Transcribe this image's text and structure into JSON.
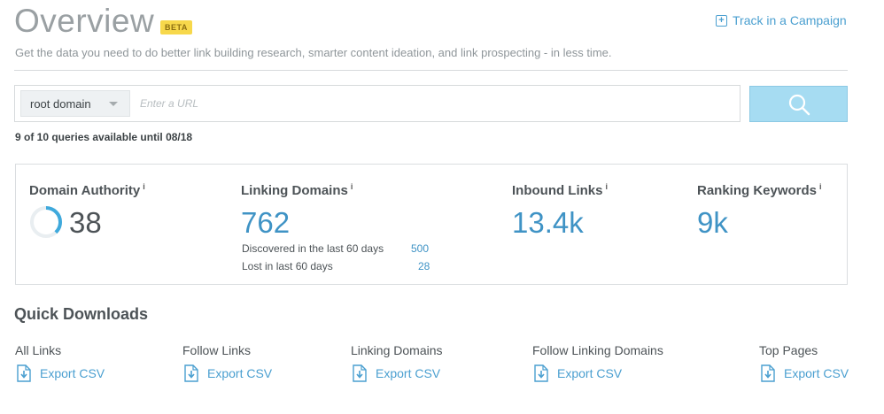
{
  "header": {
    "title": "Overview",
    "badge": "BETA",
    "track_link": "Track in a Campaign",
    "subtitle": "Get the data you need to do better link building research, smarter content ideation, and link prospecting - in less time."
  },
  "search": {
    "scope_selected": "root domain",
    "placeholder": "Enter a URL",
    "queries_note": "9 of 10 queries available until 08/18"
  },
  "metrics": {
    "domain_authority": {
      "label": "Domain Authority",
      "info": "i",
      "value": "38",
      "progress_fraction": 0.38
    },
    "linking_domains": {
      "label": "Linking Domains",
      "info": "i",
      "value": "762",
      "discovered_label": "Discovered in the last 60 days",
      "discovered_value": "500",
      "lost_label": "Lost in last 60 days",
      "lost_value": "28"
    },
    "inbound_links": {
      "label": "Inbound Links",
      "info": "i",
      "value": "13.4k"
    },
    "ranking_keywords": {
      "label": "Ranking Keywords",
      "info": "i",
      "value": "9k"
    }
  },
  "quick_downloads": {
    "title": "Quick Downloads",
    "items": [
      {
        "label": "All Links",
        "action": "Export CSV"
      },
      {
        "label": "Follow Links",
        "action": "Export CSV"
      },
      {
        "label": "Linking Domains",
        "action": "Export CSV"
      },
      {
        "label": "Follow Linking Domains",
        "action": "Export CSV"
      },
      {
        "label": "Top Pages",
        "action": "Export CSV"
      }
    ]
  },
  "colors": {
    "accent": "#3f93c5",
    "badge": "#f7d84b",
    "search_button": "#a6dcf2"
  },
  "icons": {
    "track": "plus-square-icon",
    "search": "search-icon",
    "export": "download-file-icon",
    "select": "chevron-down-icon"
  }
}
